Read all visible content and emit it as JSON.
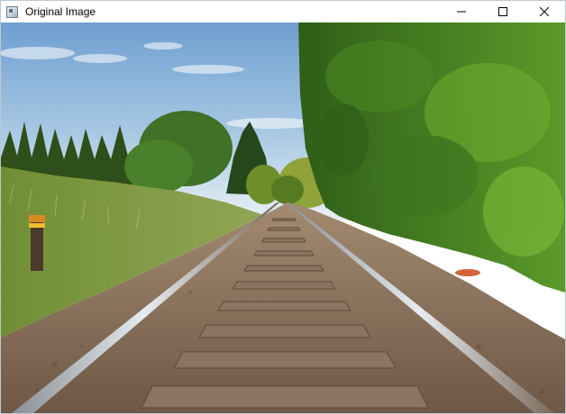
{
  "window": {
    "title": "Original Image",
    "app_icon": "image-window-icon",
    "controls": {
      "minimize_icon": "minimize-icon",
      "maximize_icon": "maximize-icon",
      "close_icon": "close-icon"
    }
  },
  "image": {
    "subject": "railway-track-photo",
    "colors": {
      "sky_top": "#6f9fd0",
      "sky_bottom": "#e8f0f5",
      "grass": "#7a9a3c",
      "foliage": "#3f7a1e",
      "ballast": "#8a6f58",
      "rail": "#b9c0c6",
      "sleeper": "#8b7460"
    }
  }
}
